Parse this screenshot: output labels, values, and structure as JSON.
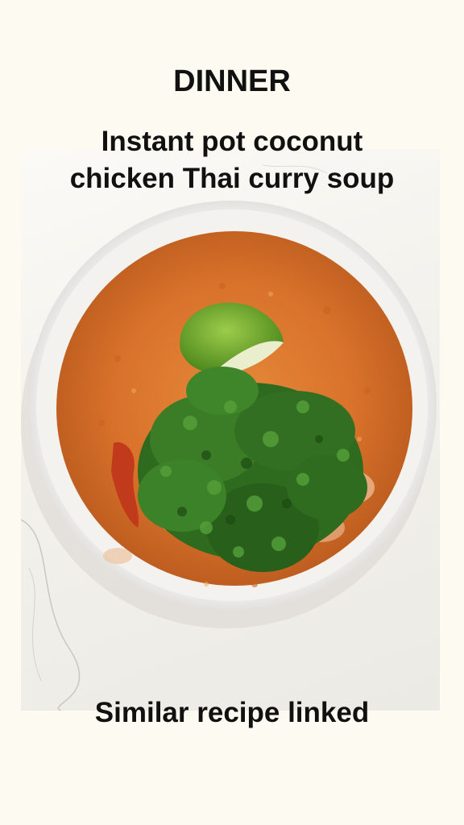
{
  "story": {
    "title": "DINNER",
    "subtitle_line1": "Instant pot coconut",
    "subtitle_line2": "chicken Thai curry soup",
    "footer": "Similar recipe linked"
  },
  "colors": {
    "background": "#fdfbf1",
    "text": "#111111",
    "soup": "#d9722b",
    "cilantro": "#2e6b1f",
    "lime": "#6fae2c",
    "bowl": "#ffffff"
  }
}
